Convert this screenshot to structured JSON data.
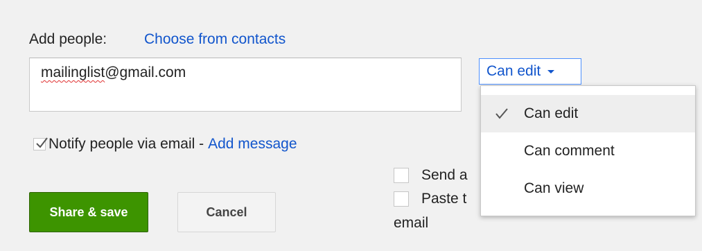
{
  "share": {
    "add_people_label": "Add people:",
    "choose_contacts_link": "Choose from contacts",
    "email_value": "mailinglist@gmail.com",
    "permission_button_label": "Can edit"
  },
  "notify": {
    "label": "Notify people via email - ",
    "add_message_link": "Add message"
  },
  "buttons": {
    "share_save": "Share & save",
    "cancel": "Cancel"
  },
  "options": {
    "send_partial": "Send a",
    "paste_partial": "Paste t",
    "email_line": "email"
  },
  "dropdown": {
    "items": [
      {
        "label": "Can edit",
        "selected": true
      },
      {
        "label": "Can comment",
        "selected": false
      },
      {
        "label": "Can view",
        "selected": false
      }
    ]
  },
  "colors": {
    "link": "#1155cc",
    "primary_button": "#3d9400",
    "selected_item_bg": "#eeeeee"
  }
}
